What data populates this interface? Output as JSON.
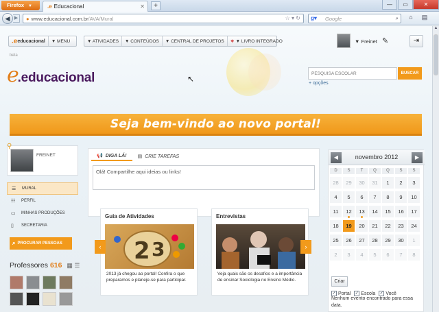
{
  "browser": {
    "app_button": "Firefox",
    "tab_title": "Educacional",
    "new_tab": "+",
    "url_prefix": "www.educacional.com.br",
    "url_path": "/AVA/Mural",
    "search_engine": "Google",
    "search_placeholder": "Google"
  },
  "topnav": {
    "logo_text": "educacional",
    "menu": "▼ MENU",
    "items": [
      "▼ ATIVIDADES",
      "▼ CONTEÚDOS",
      "▼ CENTRAL DE PROJETOS",
      "▼ LIVRO INTEGRADO"
    ]
  },
  "user": {
    "name": "▼ Freinet"
  },
  "header": {
    "beta": "beta",
    "logo": ".educacional",
    "search_placeholder": "PESQUISA ESCOLAR",
    "search_button": "BUSCAR",
    "options_link": "+ opções"
  },
  "banner": {
    "text": "Seja bem-vindo ao novo portal!"
  },
  "profile": {
    "name": "FREINET"
  },
  "menu": {
    "items": [
      {
        "label": "MURAL",
        "icon": "mural-icon"
      },
      {
        "label": "PERFIL",
        "icon": "profile-icon"
      },
      {
        "label": "MINHAS PRODUÇÕES",
        "icon": "folder-icon"
      },
      {
        "label": "SECRETARIA",
        "icon": "document-icon"
      }
    ],
    "search_people": "PROCURAR PESSOAS"
  },
  "professors": {
    "title": "Professores",
    "count": "616"
  },
  "post": {
    "tab_diga": "DIGA LÁ!",
    "tab_tarefas": "CRIE TAREFAS",
    "placeholder": "Olá! Compartilhe aqui ideias ou links!"
  },
  "features": [
    {
      "title": "Guia de Atividades",
      "desc": "2013 já chegou ao portal! Confira o que preparamos e planeje-se para participar."
    },
    {
      "title": "Entrevistas",
      "desc": "Veja quais são os desafios e a importância de ensinar Sociologia no Ensino Médio."
    }
  ],
  "calendar": {
    "month": "novembro 2012",
    "days_of_week": [
      "D",
      "S",
      "T",
      "Q",
      "Q",
      "S",
      "S"
    ],
    "weeks": [
      [
        "28",
        "29",
        "30",
        "31",
        "1",
        "2",
        "3"
      ],
      [
        "4",
        "5",
        "6",
        "7",
        "8",
        "9",
        "10"
      ],
      [
        "11",
        "12",
        "13",
        "14",
        "15",
        "16",
        "17"
      ],
      [
        "18",
        "19",
        "20",
        "21",
        "22",
        "23",
        "24"
      ],
      [
        "25",
        "26",
        "27",
        "28",
        "29",
        "30",
        "1"
      ],
      [
        "2",
        "3",
        "4",
        "5",
        "6",
        "7",
        "8"
      ]
    ],
    "today": "19",
    "filters": [
      "Portal",
      "Escola",
      "Você"
    ],
    "create_button": "Criar",
    "empty_message": "Nenhum evento encontrado para essa data."
  },
  "colors": {
    "accent": "#f29a1b",
    "brand_purple": "#4a1a5e"
  }
}
